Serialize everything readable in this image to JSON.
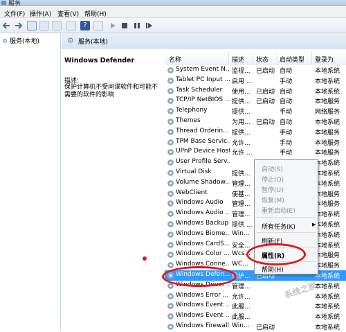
{
  "window": {
    "title": "服务"
  },
  "menu": [
    "文件(F)",
    "操作(A)",
    "查看(V)",
    "帮助(H)"
  ],
  "tree": {
    "root": "服务(本地)"
  },
  "panel": {
    "header": "服务(本地)"
  },
  "details": {
    "service_name": "Windows Defender",
    "desc_label": "描述:",
    "desc_text": "保护计算机不受间谍软件和可能不需要的软件的影响"
  },
  "columns": [
    "名称",
    "描述",
    "状态",
    "启动类型",
    "登录为"
  ],
  "services": [
    {
      "name": "System Event N...",
      "desc": "监视...",
      "status": "已启动",
      "startup": "自动",
      "logon": "本地系统"
    },
    {
      "name": "Tablet PC Input ...",
      "desc": "启用 ...",
      "status": "",
      "startup": "手动",
      "logon": "本地系统"
    },
    {
      "name": "Task Scheduler",
      "desc": "使用...",
      "status": "已启动",
      "startup": "自动",
      "logon": "本地系统"
    },
    {
      "name": "TCP/IP NetBIOS ...",
      "desc": "提供...",
      "status": "已启动",
      "startup": "自动",
      "logon": "本地服务"
    },
    {
      "name": "Telephony",
      "desc": "提供...",
      "status": "",
      "startup": "手动",
      "logon": "网络服务"
    },
    {
      "name": "Themes",
      "desc": "为用...",
      "status": "已启动",
      "startup": "自动",
      "logon": "本地系统"
    },
    {
      "name": "Thread Orderin...",
      "desc": "提供...",
      "status": "",
      "startup": "手动",
      "logon": "本地服务"
    },
    {
      "name": "TPM Base Servic...",
      "desc": "允许...",
      "status": "",
      "startup": "手动",
      "logon": "本地服务"
    },
    {
      "name": "UPnP Device Host",
      "desc": "允许 ...",
      "status": "",
      "startup": "手动",
      "logon": "本地服务"
    },
    {
      "name": "User Profile Serv...",
      "desc": "",
      "status": "",
      "startup": "",
      "logon": "本地系统"
    },
    {
      "name": "Virtual Disk",
      "desc": "提供...",
      "status": "",
      "startup": "",
      "logon": "本地系统"
    },
    {
      "name": "Volume Shadow...",
      "desc": "管理...",
      "status": "",
      "startup": "",
      "logon": "本地系统"
    },
    {
      "name": "WebClient",
      "desc": "使基...",
      "status": "",
      "startup": "",
      "logon": "本地服务"
    },
    {
      "name": "Windows Audio",
      "desc": "管理...",
      "status": "",
      "startup": "",
      "logon": "本地服务"
    },
    {
      "name": "Windows Audio ...",
      "desc": "管理...",
      "status": "",
      "startup": "",
      "logon": "本地系统"
    },
    {
      "name": "Windows Backup",
      "desc": "提供 ...",
      "status": "",
      "startup": "",
      "logon": "本地系统"
    },
    {
      "name": "Windows Biome...",
      "desc": "Win...",
      "status": "",
      "startup": "",
      "logon": "本地系统"
    },
    {
      "name": "Windows CardS...",
      "desc": "安全...",
      "status": "",
      "startup": "",
      "logon": "本地系统"
    },
    {
      "name": "Windows Color ...",
      "desc": "Wcs...",
      "status": "",
      "startup": "",
      "logon": "本地服务"
    },
    {
      "name": "Windows Conne...",
      "desc": "WC...",
      "status": "",
      "startup": "",
      "logon": "本地服务"
    },
    {
      "name": "Windows Defen...",
      "desc": "保护...",
      "status": "已启动",
      "startup": "",
      "logon": "本地系统"
    },
    {
      "name": "Windows Driver ...",
      "desc": "管理...",
      "status": "",
      "startup": "",
      "logon": "本地系统"
    },
    {
      "name": "Windows Error ...",
      "desc": "允许...",
      "status": "",
      "startup": "",
      "logon": "本地系统"
    },
    {
      "name": "Windows Event ...",
      "desc": "此服...",
      "status": "",
      "startup": "",
      "logon": "本地系统"
    },
    {
      "name": "Windows Event ...",
      "desc": "此服...",
      "status": "",
      "startup": "",
      "logon": "本地系统"
    },
    {
      "name": "Windows Firewall",
      "desc": "Win...",
      "status": "已启动",
      "startup": "",
      "logon": "本地系统"
    }
  ],
  "context_menu": {
    "start": "启动(S)",
    "stop": "停止(O)",
    "pause": "暂停(U)",
    "resume": "恢复(M)",
    "restart": "重新启动(E)",
    "all_tasks": "所有任务(K)",
    "refresh": "刷新(F)",
    "properties": "属性(R)",
    "help": "帮助(H)"
  },
  "watermark": "系统之家",
  "colors": {
    "selection": "#3399ff",
    "annotation": "#e01818"
  }
}
